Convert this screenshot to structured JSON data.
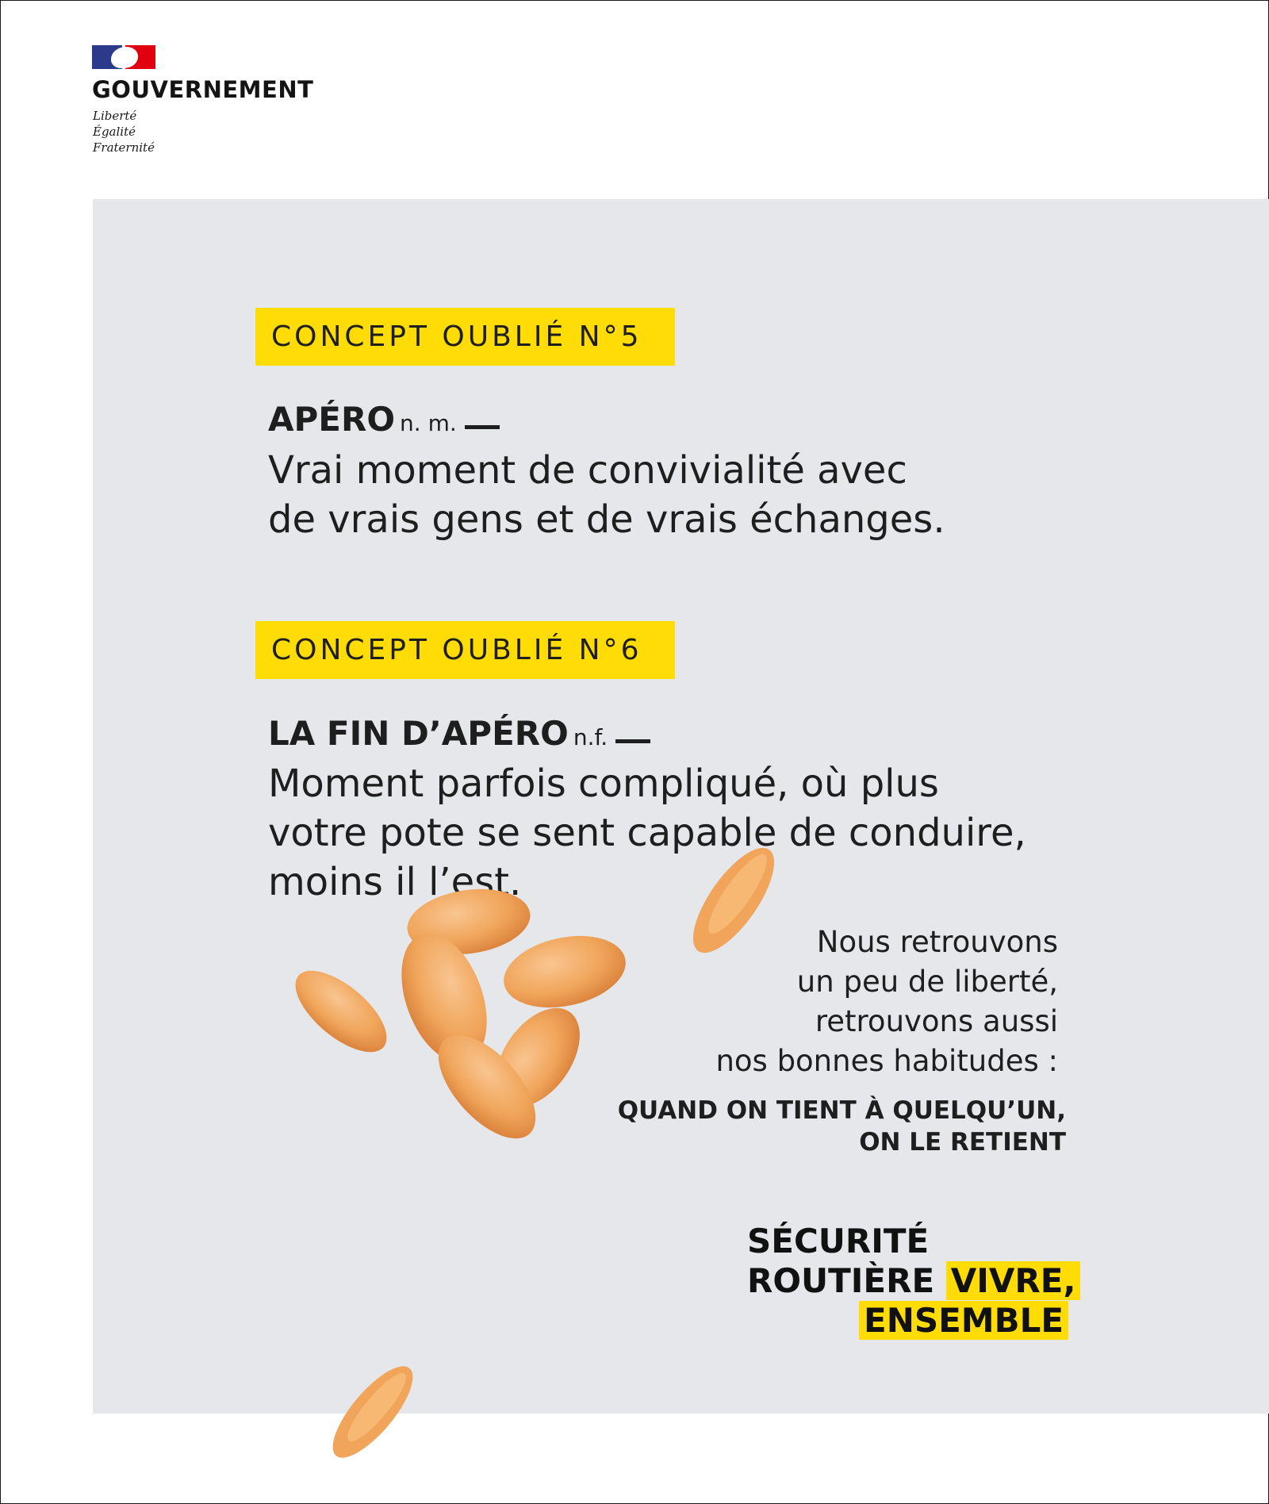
{
  "header": {
    "government": "GOUVERNEMENT",
    "motto": [
      "Liberté",
      "Égalité",
      "Fraternité"
    ]
  },
  "concept5": {
    "tag": "CONCEPT OUBLIÉ N°5",
    "word": "APÉRO",
    "grammar": "n. m.",
    "definition": [
      "Vrai moment de convivialité avec",
      "de vrais gens et de vrais échanges."
    ]
  },
  "concept6": {
    "tag": "CONCEPT OUBLIÉ N°6",
    "word": "LA FIN D’APÉRO",
    "grammar": "n.f.",
    "definition": [
      "Moment parfois compliqué, où plus",
      "votre pote se sent capable de conduire,",
      "moins il l’est."
    ]
  },
  "message": {
    "lines": [
      "Nous retrouvons",
      "un peu de liberté,",
      "retrouvons aussi",
      "nos bonnes habitudes :"
    ],
    "slogan": [
      "QUAND ON TIENT À QUELQU’UN,",
      "ON LE RETIENT"
    ]
  },
  "brand": {
    "line1": "SÉCURITÉ",
    "line2a": "ROUTIÈRE",
    "line2b": "VIVRE,",
    "line3": "ENSEMBLE"
  },
  "colors": {
    "accent_yellow": "#ffdc05",
    "panel_grey": "#e6e7ea",
    "flag_blue": "#2c3a8c",
    "flag_red": "#e1000f",
    "peanut": "#f0a55a"
  }
}
